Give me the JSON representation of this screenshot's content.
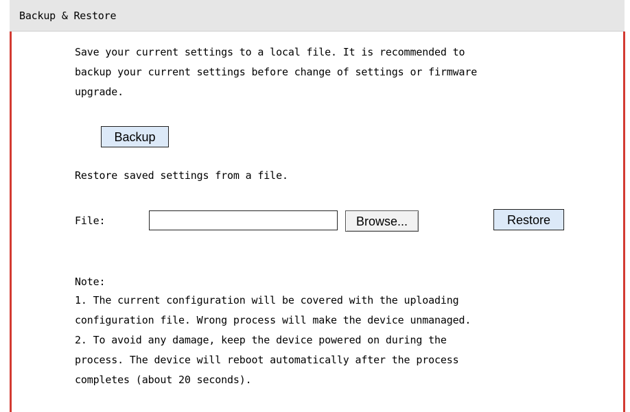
{
  "panel": {
    "title": "Backup & Restore"
  },
  "backup": {
    "description_lines": [
      "Save your current settings to a local file. It is recommended to",
      "backup your current settings before change of settings or firmware",
      "upgrade."
    ],
    "button_label": "Backup"
  },
  "restore": {
    "description": "Restore saved settings from a file.",
    "file_label": "File:",
    "file_value": "",
    "browse_label": "Browse...",
    "restore_label": "Restore"
  },
  "note": {
    "heading": "Note:",
    "lines": [
      "1. The current configuration will be covered with the uploading",
      "configuration file. Wrong process will make the device unmanaged.",
      "2. To avoid any damage, keep the device powered on during the",
      "process. The device will reboot automatically after the process",
      "completes (about 20 seconds)."
    ]
  },
  "colors": {
    "header_bg": "#e6e6e6",
    "accent_border": "#d33a32",
    "button_bg": "#dce9f8"
  }
}
